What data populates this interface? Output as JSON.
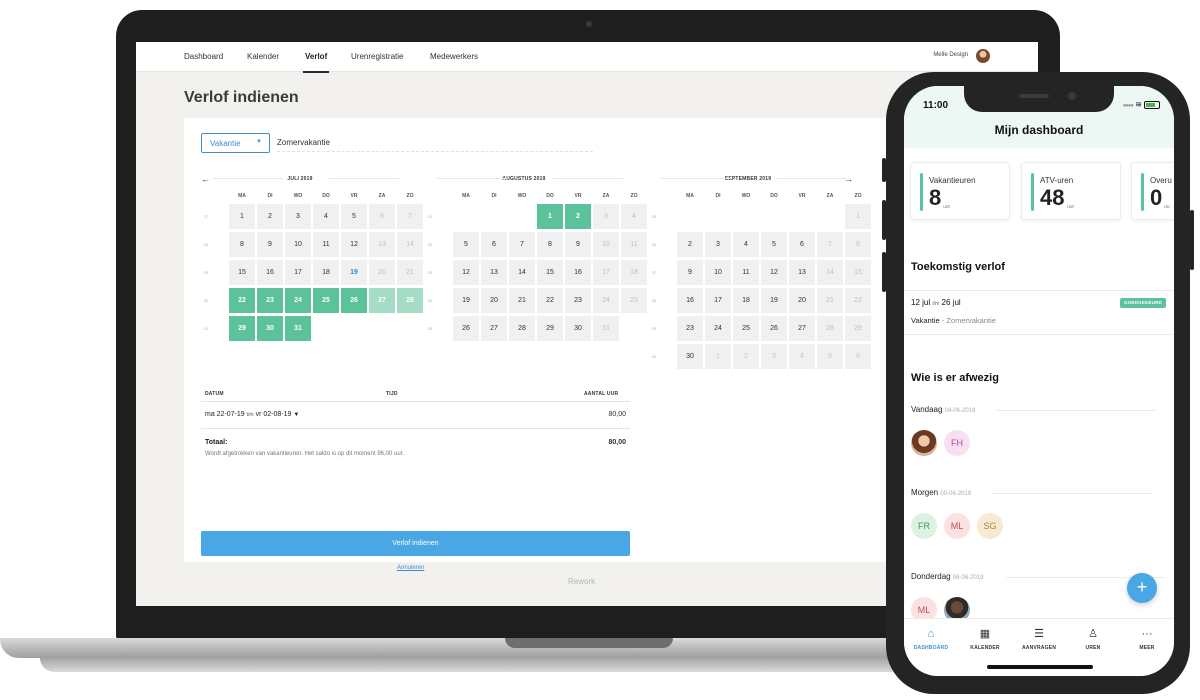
{
  "nav": {
    "items": [
      "Dashboard",
      "Kalender",
      "Verlof",
      "Urenregistratie",
      "Medewerkers"
    ],
    "active_index": 2,
    "user_name": "Melle Design"
  },
  "page": {
    "title": "Verlof indienen",
    "footer_brand": "Rework"
  },
  "form": {
    "leave_type": "Vakantie",
    "description": "Zomervakantie"
  },
  "calendar": {
    "weekdays": [
      "MA",
      "DI",
      "WO",
      "DO",
      "VR",
      "ZA",
      "ZO"
    ],
    "months": [
      {
        "title": "JULI 2019",
        "weeks": [
          {
            "wk": "27",
            "days": [
              {
                "d": "1"
              },
              {
                "d": "2"
              },
              {
                "d": "3"
              },
              {
                "d": "4"
              },
              {
                "d": "5"
              },
              {
                "d": "6",
                "s": "we"
              },
              {
                "d": "7",
                "s": "we"
              }
            ]
          },
          {
            "wk": "28",
            "days": [
              {
                "d": "8"
              },
              {
                "d": "9"
              },
              {
                "d": "10"
              },
              {
                "d": "11"
              },
              {
                "d": "12"
              },
              {
                "d": "13",
                "s": "we"
              },
              {
                "d": "14",
                "s": "we"
              }
            ]
          },
          {
            "wk": "29",
            "days": [
              {
                "d": "15"
              },
              {
                "d": "16"
              },
              {
                "d": "17"
              },
              {
                "d": "18"
              },
              {
                "d": "19",
                "s": "today"
              },
              {
                "d": "20",
                "s": "we"
              },
              {
                "d": "21",
                "s": "we"
              }
            ]
          },
          {
            "wk": "30",
            "days": [
              {
                "d": "22",
                "s": "sel"
              },
              {
                "d": "23",
                "s": "sel"
              },
              {
                "d": "24",
                "s": "sel"
              },
              {
                "d": "25",
                "s": "sel"
              },
              {
                "d": "26",
                "s": "sel"
              },
              {
                "d": "27",
                "s": "selwe"
              },
              {
                "d": "28",
                "s": "selwe"
              }
            ]
          },
          {
            "wk": "31",
            "days": [
              {
                "d": "29",
                "s": "sel"
              },
              {
                "d": "30",
                "s": "sel"
              },
              {
                "d": "31",
                "s": "sel"
              },
              null,
              null,
              null,
              null
            ]
          }
        ]
      },
      {
        "title": "AUGUSTUS 2019",
        "weeks": [
          {
            "wk": "31",
            "days": [
              null,
              null,
              null,
              {
                "d": "1",
                "s": "sel"
              },
              {
                "d": "2",
                "s": "sel"
              },
              {
                "d": "3",
                "s": "we"
              },
              {
                "d": "4",
                "s": "we"
              }
            ]
          },
          {
            "wk": "32",
            "days": [
              {
                "d": "5"
              },
              {
                "d": "6"
              },
              {
                "d": "7"
              },
              {
                "d": "8"
              },
              {
                "d": "9"
              },
              {
                "d": "10",
                "s": "we"
              },
              {
                "d": "11",
                "s": "we"
              }
            ]
          },
          {
            "wk": "33",
            "days": [
              {
                "d": "12"
              },
              {
                "d": "13"
              },
              {
                "d": "14"
              },
              {
                "d": "15"
              },
              {
                "d": "16"
              },
              {
                "d": "17",
                "s": "we"
              },
              {
                "d": "18",
                "s": "we"
              }
            ]
          },
          {
            "wk": "34",
            "days": [
              {
                "d": "19"
              },
              {
                "d": "20"
              },
              {
                "d": "21"
              },
              {
                "d": "22"
              },
              {
                "d": "23"
              },
              {
                "d": "24",
                "s": "we"
              },
              {
                "d": "25",
                "s": "we"
              }
            ]
          },
          {
            "wk": "35",
            "days": [
              {
                "d": "26"
              },
              {
                "d": "27"
              },
              {
                "d": "28"
              },
              {
                "d": "29"
              },
              {
                "d": "30"
              },
              {
                "d": "31",
                "s": "we"
              },
              null
            ]
          }
        ]
      },
      {
        "title": "SEPTEMBER 2019",
        "weeks": [
          {
            "wk": "35",
            "days": [
              null,
              null,
              null,
              null,
              null,
              null,
              {
                "d": "1",
                "s": "we"
              }
            ]
          },
          {
            "wk": "36",
            "days": [
              {
                "d": "2"
              },
              {
                "d": "3"
              },
              {
                "d": "4"
              },
              {
                "d": "5"
              },
              {
                "d": "6"
              },
              {
                "d": "7",
                "s": "we"
              },
              {
                "d": "8",
                "s": "we"
              }
            ]
          },
          {
            "wk": "37",
            "days": [
              {
                "d": "9"
              },
              {
                "d": "10"
              },
              {
                "d": "11"
              },
              {
                "d": "12"
              },
              {
                "d": "13"
              },
              {
                "d": "14",
                "s": "we"
              },
              {
                "d": "15",
                "s": "we"
              }
            ]
          },
          {
            "wk": "38",
            "days": [
              {
                "d": "16"
              },
              {
                "d": "17"
              },
              {
                "d": "18"
              },
              {
                "d": "19"
              },
              {
                "d": "20"
              },
              {
                "d": "21",
                "s": "we"
              },
              {
                "d": "22",
                "s": "we"
              }
            ]
          },
          {
            "wk": "39",
            "days": [
              {
                "d": "23"
              },
              {
                "d": "24"
              },
              {
                "d": "25"
              },
              {
                "d": "26"
              },
              {
                "d": "27"
              },
              {
                "d": "28",
                "s": "we"
              },
              {
                "d": "29",
                "s": "we"
              }
            ]
          },
          {
            "wk": "40",
            "days": [
              {
                "d": "30"
              },
              {
                "d": "1",
                "s": "out"
              },
              {
                "d": "2",
                "s": "out"
              },
              {
                "d": "3",
                "s": "out"
              },
              {
                "d": "4",
                "s": "out"
              },
              {
                "d": "5",
                "s": "out"
              },
              {
                "d": "6",
                "s": "out"
              }
            ]
          }
        ]
      }
    ]
  },
  "summary": {
    "col_date": "DATUM",
    "col_time": "TIJD",
    "col_hours": "AANTAL UUR",
    "range_from": "ma 22-07-19",
    "range_sep": "t/m",
    "range_to": "vr 02-08-19",
    "range_hours": "80,00",
    "total_label": "Totaal:",
    "total_hours": "80,00",
    "note": "Wordt afgetrokken van vakantieuren. Het saldo is op dit moment 96,00 uur.",
    "submit_label": "Verlof indienen",
    "cancel_label": "Annuleren"
  },
  "phone": {
    "time": "11:00",
    "title": "Mijn dashboard",
    "stats": [
      {
        "label": "Vakantieuren",
        "value": "8",
        "unit": "uur"
      },
      {
        "label": "ATV-uren",
        "value": "48",
        "unit": "uur"
      },
      {
        "label": "Overu",
        "value": "0",
        "unit": "uu"
      }
    ],
    "upcoming_title": "Toekomstig verlof",
    "leave": {
      "from": "12 jul",
      "sep": "t/m",
      "to": "26 jul",
      "status": "GOEDGEKEURD",
      "type": "Vakantie",
      "dash": " - ",
      "desc": "Zomervakantie"
    },
    "absent_title": "Wie is er afwezig",
    "absent_days": [
      {
        "label": "Vandaag",
        "date": "04-06-2019",
        "people": [
          {
            "initials": "",
            "photo": "1"
          },
          {
            "initials": "FH",
            "color": "#f8dff2",
            "text": "#b04a9a"
          }
        ]
      },
      {
        "label": "Morgen",
        "date": "05-06-2019",
        "people": [
          {
            "initials": "FR",
            "color": "#dcf3e2",
            "text": "#3a9a5c"
          },
          {
            "initials": "ML",
            "color": "#fbe1e1",
            "text": "#c05050"
          },
          {
            "initials": "SG",
            "color": "#f7ead2",
            "text": "#b08430"
          }
        ]
      },
      {
        "label": "Donderdag",
        "date": "06-06-2019",
        "people": [
          {
            "initials": "ML",
            "color": "#fbe1e1",
            "text": "#c05050"
          },
          {
            "initials": "",
            "photo": "2"
          }
        ]
      }
    ],
    "tabs": [
      {
        "label": "DASHBOARD",
        "icon": "home-icon"
      },
      {
        "label": "KALENDER",
        "icon": "calendar-icon"
      },
      {
        "label": "AANVRAGEN",
        "icon": "list-icon"
      },
      {
        "label": "UREN",
        "icon": "user-clock-icon"
      },
      {
        "label": "MEER",
        "icon": "more-icon"
      }
    ]
  },
  "colors": {
    "accent_blue": "#4aa7e6",
    "selected_green": "#5cc29a",
    "selected_weekend": "#a4dcc6",
    "today_blue": "#2e86de"
  }
}
